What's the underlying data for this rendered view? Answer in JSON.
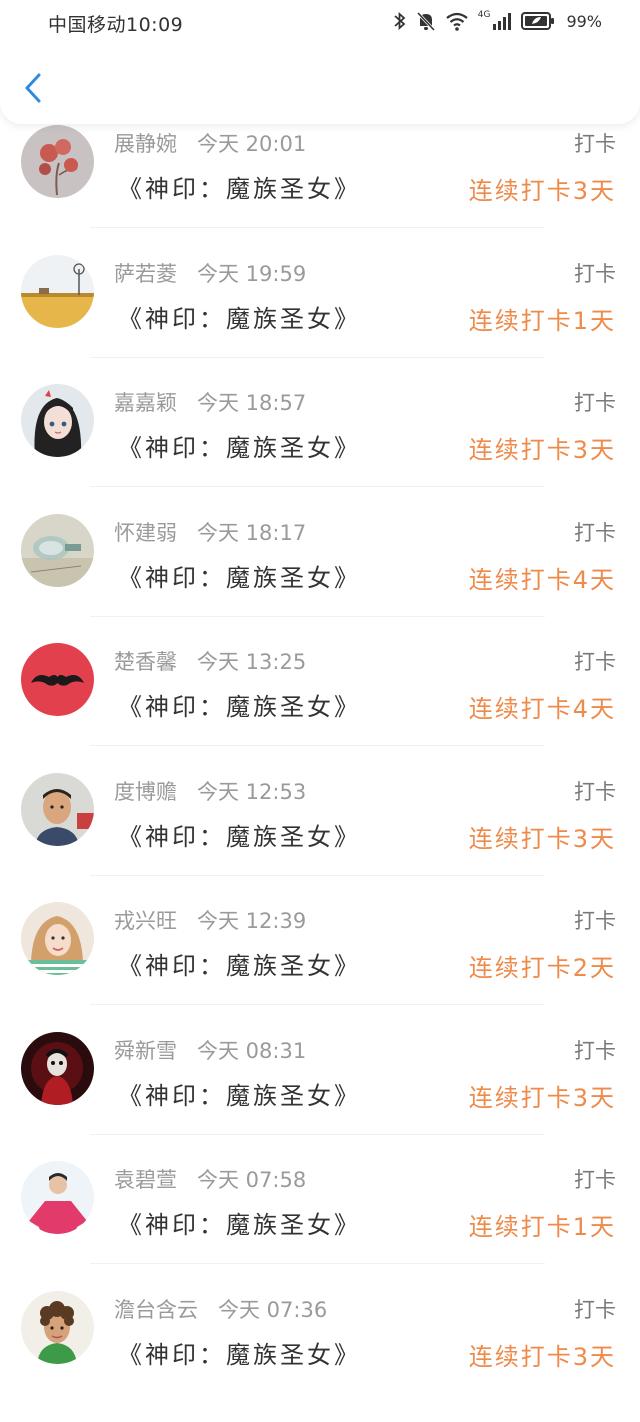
{
  "status_bar": {
    "carrier_time": "中国移动10:09",
    "network": "4G",
    "battery": "99%",
    "icons": [
      "bluetooth-icon",
      "bell-off-icon",
      "wifi-icon",
      "signal-icon",
      "battery-icon"
    ]
  },
  "nav": {
    "back_icon": "chevron-left-icon"
  },
  "colors": {
    "accent": "#2e8be0",
    "streak": "#ee8a4a",
    "muted": "#9a9a9a"
  },
  "items": [
    {
      "name": "展静婉",
      "time": "今天 20:01",
      "action": "打卡",
      "book": "《神印：魔族圣女》",
      "streak": "连续打卡3天",
      "avatar": "flower-avatar"
    },
    {
      "name": "萨若菱",
      "time": "今天 19:59",
      "action": "打卡",
      "book": "《神印：魔族圣女》",
      "streak": "连续打卡1天",
      "avatar": "windmill-field-avatar"
    },
    {
      "name": "嘉嘉颖",
      "time": "今天 18:57",
      "action": "打卡",
      "book": "《神印：魔族圣女》",
      "streak": "连续打卡3天",
      "avatar": "anime-girl-avatar"
    },
    {
      "name": "怀建弱",
      "time": "今天 18:17",
      "action": "打卡",
      "book": "《神印：魔族圣女》",
      "streak": "连续打卡4天",
      "avatar": "glass-bottle-avatar"
    },
    {
      "name": "楚香馨",
      "time": "今天 13:25",
      "action": "打卡",
      "book": "《神印：魔族圣女》",
      "streak": "连续打卡4天",
      "avatar": "mustache-avatar"
    },
    {
      "name": "度博赡",
      "time": "今天 12:53",
      "action": "打卡",
      "book": "《神印：魔族圣女》",
      "streak": "连续打卡3天",
      "avatar": "boy-photo-avatar"
    },
    {
      "name": "戎兴旺",
      "time": "今天 12:39",
      "action": "打卡",
      "book": "《神印：魔族圣女》",
      "streak": "连续打卡2天",
      "avatar": "girl-photo-avatar"
    },
    {
      "name": "舜新雪",
      "time": "今天 08:31",
      "action": "打卡",
      "book": "《神印：魔族圣女》",
      "streak": "连续打卡3天",
      "avatar": "dark-art-avatar"
    },
    {
      "name": "袁碧萱",
      "time": "今天 07:58",
      "action": "打卡",
      "book": "《神印：魔族圣女》",
      "streak": "连续打卡1天",
      "avatar": "pink-shirt-avatar"
    },
    {
      "name": "澹台含云",
      "time": "今天 07:36",
      "action": "打卡",
      "book": "《神印：魔族圣女》",
      "streak": "连续打卡3天",
      "avatar": "curly-kid-avatar"
    }
  ]
}
